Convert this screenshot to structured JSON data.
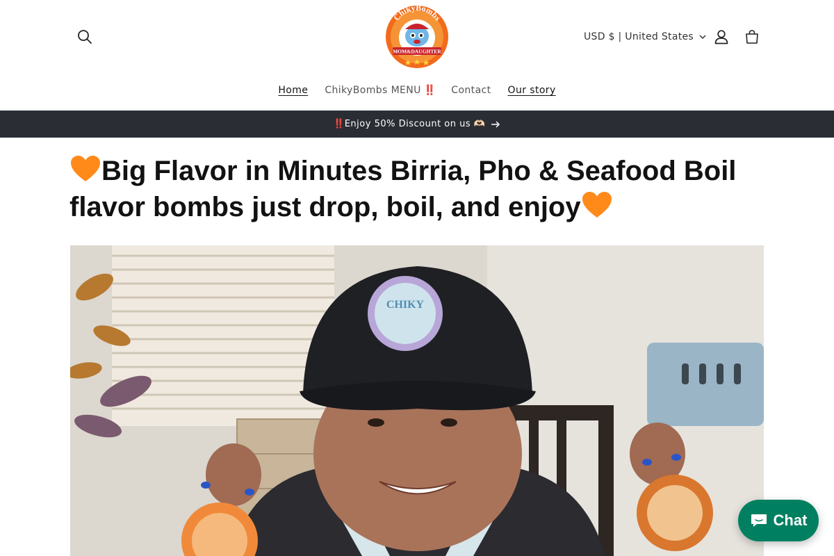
{
  "header": {
    "logo_text": "ChikyBombs",
    "logo_banner": "MOM&DAUGHTER",
    "currency_label": "USD $ | United States",
    "icons": {
      "search": "search-icon",
      "account": "user-icon",
      "cart": "shopping-bag-icon",
      "currency_chevron": "chevron-down-icon"
    }
  },
  "nav": {
    "items": [
      {
        "label": "Home"
      },
      {
        "label": "ChikyBombs MENU",
        "suffix": "‼️"
      },
      {
        "label": "Contact"
      },
      {
        "label": "Our story"
      }
    ]
  },
  "announcement": {
    "prefix": "‼️",
    "text": "Enjoy 50% Discount on us",
    "emoji": "🫶🏻",
    "arrow_icon": "arrow-right-icon"
  },
  "headline": {
    "line1": "Big Flavor in Minutes Birria, Pho & Seafood Boil",
    "line2": "flavor bombs just drop, boil, and enjoy",
    "emoji": "🧡"
  },
  "hero": {
    "patch_text": "CHIKY"
  },
  "chat": {
    "label": "Chat",
    "icon": "chat-bubble-icon"
  },
  "colors": {
    "announcement_bg": "#2a2e34",
    "chat_bg": "#008060",
    "heart": "#ff8a1a",
    "logo_orange": "#f26b1d"
  }
}
